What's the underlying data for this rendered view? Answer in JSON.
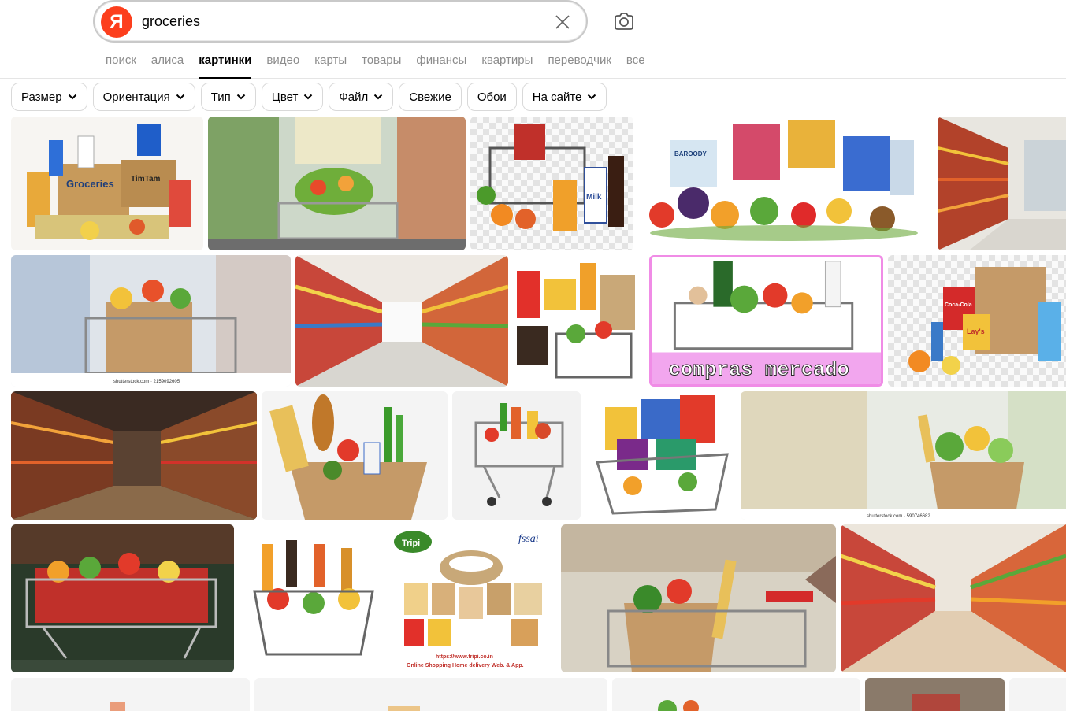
{
  "search": {
    "query": "groceries",
    "logo_letter": "Я",
    "clear_icon": "close-icon",
    "camera_icon": "camera-search-icon"
  },
  "tabs": [
    {
      "label": "поиск",
      "active": false
    },
    {
      "label": "алиса",
      "active": false
    },
    {
      "label": "картинки",
      "active": true
    },
    {
      "label": "видео",
      "active": false
    },
    {
      "label": "карты",
      "active": false
    },
    {
      "label": "товары",
      "active": false
    },
    {
      "label": "финансы",
      "active": false
    },
    {
      "label": "квартиры",
      "active": false
    },
    {
      "label": "переводчик",
      "active": false
    },
    {
      "label": "все",
      "active": false
    }
  ],
  "filters": [
    {
      "label": "Размер",
      "dropdown": true
    },
    {
      "label": "Ориентация",
      "dropdown": true
    },
    {
      "label": "Тип",
      "dropdown": true
    },
    {
      "label": "Цвет",
      "dropdown": true
    },
    {
      "label": "Файл",
      "dropdown": true
    },
    {
      "label": "Свежие",
      "dropdown": false
    },
    {
      "label": "Обои",
      "dropdown": false
    },
    {
      "label": "На сайте",
      "dropdown": true
    }
  ],
  "image_texts": {
    "watermark_1": "shutterstock.com · 2159092605",
    "watermark_2": "shutterstock.com · 590746682",
    "compras_caption": "compras mercado",
    "tripi_brand": "Tripi",
    "fssai": "fssai",
    "tripi_url": "https://www.tripi.co.in",
    "tripi_tagline": "Online Shopping Home delivery Web. & App.",
    "groceries_box": "Groceries",
    "timtam": "TimTam",
    "milk": "Milk",
    "lays": "Lay's",
    "coca_cola": "Coca-Cola",
    "barooqy": "BAROODY"
  },
  "colors": {
    "brand": "#fc3f1d",
    "tab_inactive": "#8c8c8c",
    "compras_border": "#f08ce6",
    "compras_bg": "#f2a6ee"
  }
}
